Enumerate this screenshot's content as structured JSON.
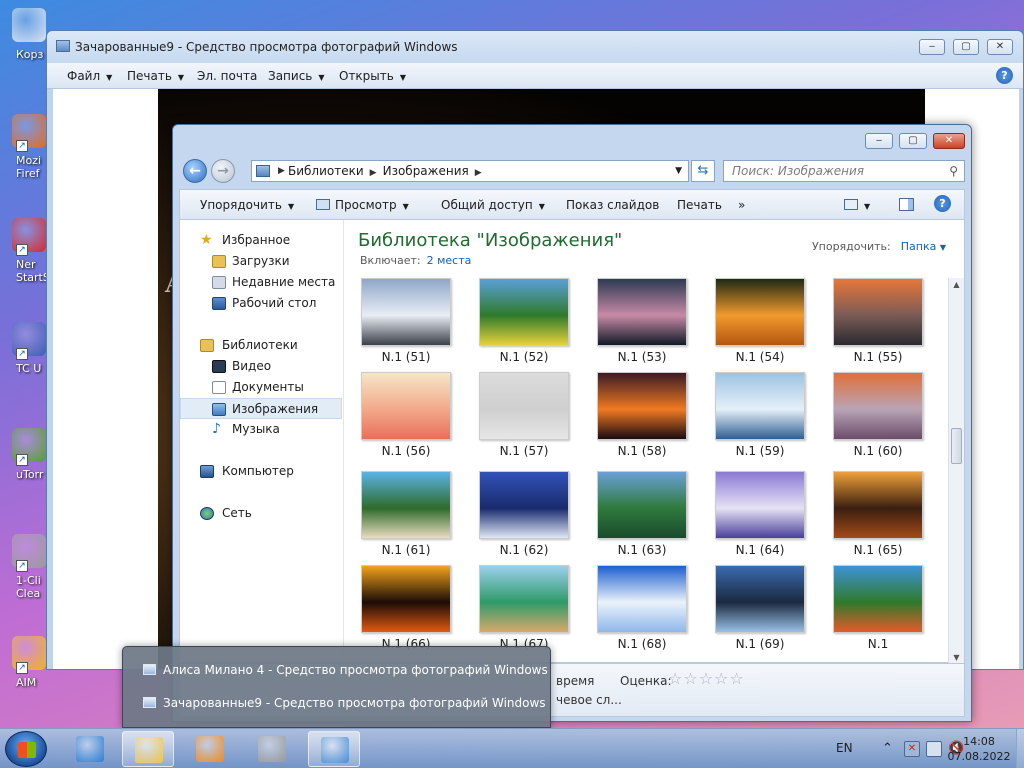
{
  "desktop": {
    "icons": [
      {
        "label": "Корз",
        "icon": "recycle-bin-icon",
        "color": "#d8e4f0"
      },
      {
        "label": "Mozi\nFiref",
        "icon": "firefox-icon",
        "color": "#e66a1f"
      },
      {
        "label": "Ner\nStartSm",
        "icon": "nero-icon",
        "color": "#d62a2a"
      },
      {
        "label": "TC U",
        "icon": "total-commander-icon",
        "color": "#3b5fb5"
      },
      {
        "label": "uTorr",
        "icon": "utorrent-icon",
        "color": "#55a02c"
      },
      {
        "label": "1-Cli\nClea",
        "icon": "cleaner-icon",
        "color": "#9a9a9a"
      },
      {
        "label": "AIM",
        "icon": "aimp-icon",
        "color": "#f2b41a"
      }
    ]
  },
  "photo_viewer": {
    "title": "Зачарованные9 - Средство просмотра фотографий Windows",
    "menu": [
      "Файл",
      "Печать",
      "Эл. почта",
      "Запись",
      "Открыть"
    ],
    "photo_text": "A",
    "help": "?"
  },
  "explorer": {
    "breadcrumb": [
      "Библиотеки",
      "Изображения"
    ],
    "search_placeholder": "Поиск: Изображения",
    "commands": [
      "Упорядочить",
      "Просмотр",
      "Общий доступ",
      "Показ слайдов",
      "Печать",
      "»"
    ],
    "nav": {
      "favorites_header": "Избранное",
      "favorites": [
        "Загрузки",
        "Недавние места",
        "Рабочий стол"
      ],
      "libraries_header": "Библиотеки",
      "libraries": [
        "Видео",
        "Документы",
        "Изображения",
        "Музыка"
      ],
      "selected": "Изображения",
      "computer": "Компьютер",
      "network": "Сеть"
    },
    "library_title": "Библиотека \"Изображения\"",
    "includes_label": "Включает:",
    "includes_link": "2 места",
    "arrange_label": "Упорядочить:",
    "arrange_value": "Папка",
    "thumbnails": [
      {
        "name": "N.1 (51)",
        "colors": [
          "#8fa6c8",
          "#e9eef5",
          "#3b3f48"
        ]
      },
      {
        "name": "N.1 (52)",
        "colors": [
          "#5aa0d8",
          "#2f7a2c",
          "#e7d13a"
        ]
      },
      {
        "name": "N.1 (53)",
        "colors": [
          "#2d3a52",
          "#c78aa6",
          "#101a26"
        ]
      },
      {
        "name": "N.1 (54)",
        "colors": [
          "#1e2a14",
          "#f29a2e",
          "#b3560f"
        ]
      },
      {
        "name": "N.1 (55)",
        "colors": [
          "#e8773a",
          "#7a5b56",
          "#2a2a30"
        ]
      },
      {
        "name": "N.1 (56)",
        "colors": [
          "#f6e6c8",
          "#f2a98a",
          "#e86f5a"
        ]
      },
      {
        "name": "N.1 (57)",
        "colors": [
          "#dcdcdc",
          "#cfcfcf",
          "#e6e6e6"
        ]
      },
      {
        "name": "N.1 (58)",
        "colors": [
          "#3b1a25",
          "#f07a22",
          "#1a0c12"
        ]
      },
      {
        "name": "N.1 (59)",
        "colors": [
          "#9cc3e3",
          "#e6f0f8",
          "#2e5f96"
        ]
      },
      {
        "name": "N.1 (60)",
        "colors": [
          "#e0703a",
          "#b9a4b6",
          "#6b4c6a"
        ]
      },
      {
        "name": "N.1 (61)",
        "colors": [
          "#5ab3e6",
          "#2f6a2a",
          "#e9dcc0"
        ]
      },
      {
        "name": "N.1 (62)",
        "colors": [
          "#3152b8",
          "#1a2b6e",
          "#dfe8f7"
        ]
      },
      {
        "name": "N.1 (63)",
        "colors": [
          "#6aa0d6",
          "#2f7a3c",
          "#1a4a2e"
        ]
      },
      {
        "name": "N.1 (64)",
        "colors": [
          "#8a7ad6",
          "#e6e2f4",
          "#4a3f9a"
        ]
      },
      {
        "name": "N.1 (65)",
        "colors": [
          "#f0a03a",
          "#3a1e10",
          "#a44a18"
        ]
      },
      {
        "name": "N.1 (66)",
        "colors": [
          "#f2a21c",
          "#1a0c06",
          "#e35a12"
        ]
      },
      {
        "name": "N.1 (67)",
        "colors": [
          "#9ad0ec",
          "#2f9a6a",
          "#d8a86a"
        ]
      },
      {
        "name": "N.1 (68)",
        "colors": [
          "#1e5fd0",
          "#eaf2fb",
          "#8fb8ea"
        ]
      },
      {
        "name": "N.1 (69)",
        "colors": [
          "#3a6ab0",
          "#1a2a40",
          "#9ac0e6"
        ]
      },
      {
        "name": "N.1",
        "colors": [
          "#3e92d6",
          "#2f7a2c",
          "#e55a2a"
        ]
      }
    ],
    "details": {
      "date_label": "время",
      "rating_label": "Оценка:",
      "stars": 5,
      "keywords_label": "чевое сл..."
    }
  },
  "popup": {
    "items": [
      "Алиса Милано 4 - Средство просмотра фотографий Windows",
      "Зачарованные9 - Средство просмотра фотографий Windows"
    ]
  },
  "taskbar": {
    "apps": [
      {
        "icon": "ie-icon",
        "color": "#2a7fd6",
        "open": false
      },
      {
        "icon": "explorer-folder-icon",
        "color": "#f0c64a",
        "open": true
      },
      {
        "icon": "media-player-icon",
        "color": "#f28a1e",
        "open": false
      },
      {
        "icon": "installer-icon",
        "color": "#9a9a9a",
        "open": false
      },
      {
        "icon": "photo-viewer-icon",
        "color": "#4a8fd6",
        "open": true
      }
    ],
    "lang": "EN",
    "time": "14:08",
    "date": "07.08.2022"
  }
}
